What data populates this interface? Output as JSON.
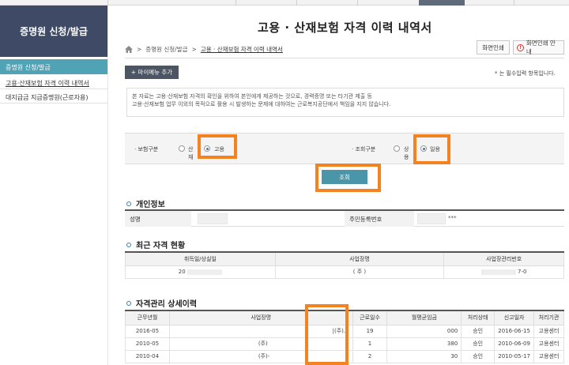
{
  "sidebar": {
    "title": "증명원 신청/발급",
    "section": "증명원 신청/발급",
    "items": [
      {
        "label": "고용·산재보험 자격 이력 내역서"
      },
      {
        "label": "대지급금 지급증명원(근로자용)"
      }
    ]
  },
  "page": {
    "title": "고용 · 산재보험 자격 이력 내역서",
    "breadcrumb": [
      "증명원 신청/발급",
      "고용 · 산재보험 자격 이력 내역서"
    ],
    "print_label": "화면인쇄",
    "print_guide_label": "화면인쇄 안내",
    "mymenu_label": "+ 마이메뉴 추가",
    "required_note": "* 는 필수입력 항목입니다.",
    "notice_line1": "본 자료는 고용·산재보험 자격의 확인을 위하여 본인에게 제공하는 것으로, 경력증명 또는 타기관 제출 등",
    "notice_line2": "고용·산재보험 업무 이외의 목적으로 활용 시 발생하는 문제에 대하여는 근로복지공단에서 책임을 지지 않습니다."
  },
  "search": {
    "insurance_label": "· 보험구분",
    "insurance_options": [
      "산재",
      "고용"
    ],
    "insurance_selected": "고용",
    "query_label": "· 조회구분",
    "query_options": [
      "상용",
      "일용"
    ],
    "query_selected": "일용",
    "button_label": "조회"
  },
  "personal": {
    "heading": "개인정보",
    "name_label": "성명",
    "rrn_label": "주민등록번호",
    "rrn_value": "***"
  },
  "recent": {
    "heading": "최근 자격 현황",
    "columns": [
      "취득일/상실일",
      "사업장명",
      "사업장관리번호"
    ],
    "rows": [
      [
        "20",
        "( 주 )",
        "7-0"
      ]
    ]
  },
  "history": {
    "heading": "자격관리 상세이력",
    "columns": [
      "근무년월",
      "사업장명",
      "근로일수",
      "월평균임금",
      "처리상태",
      "신고일자",
      "처리기관"
    ],
    "rows": [
      [
        "2016-05",
        "|(주)...",
        "19",
        "000",
        "승인",
        "2016-06-15",
        "고용센터"
      ],
      [
        "2010-05",
        "(주)",
        "1",
        "380",
        "승인",
        "2010-06-09",
        "고용센터"
      ],
      [
        "2010-04",
        "(주)-",
        "2",
        "30",
        "승인",
        "2010-05-17",
        "고용센터"
      ]
    ]
  },
  "colors": {
    "sidebar_head": "#3f4a66",
    "sidebar_sub": "#4fa3b5",
    "highlight": "#f58220",
    "search_button": "#4b95a8"
  }
}
